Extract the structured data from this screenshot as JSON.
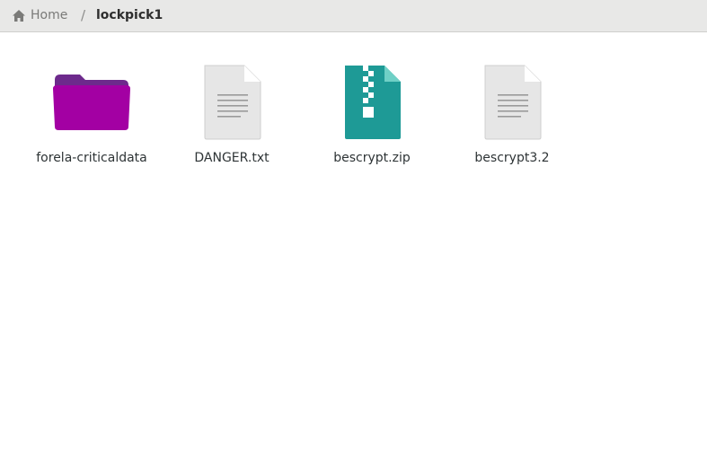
{
  "pathbar": {
    "home_label": "Home",
    "separator": "/",
    "current_folder": "lockpick1"
  },
  "files": [
    {
      "name": "forela-criticaldata",
      "icon": "folder-icon",
      "color": "#a300a3"
    },
    {
      "name": "DANGER.txt",
      "icon": "text-file-icon",
      "color": "#e8e8e8"
    },
    {
      "name": "bescrypt.zip",
      "icon": "zip-archive-icon",
      "color": "#1e9a96"
    },
    {
      "name": "bescrypt3.2",
      "icon": "text-file-icon",
      "color": "#e8e8e8"
    }
  ]
}
